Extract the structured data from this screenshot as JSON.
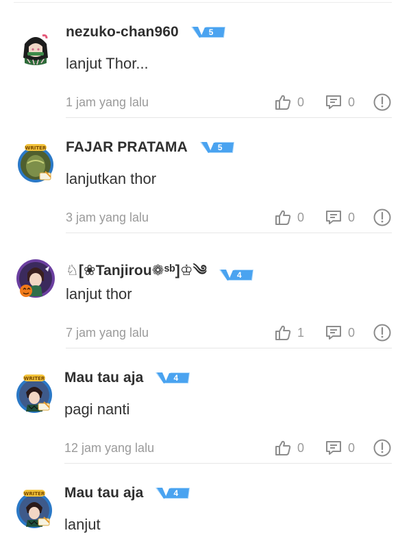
{
  "comments": [
    {
      "username": "nezuko-chan960",
      "level": "5",
      "text": "lanjut Thor...",
      "time": "1 jam yang lalu",
      "likes": "0",
      "replies": "0",
      "avatar_icon": "avatar-nezuko-icon"
    },
    {
      "username": "FAJAR PRATAMA",
      "level": "5",
      "text": "lanjutkan thor",
      "time": "3 jam yang lalu",
      "likes": "0",
      "replies": "0",
      "avatar_icon": "avatar-writer-frame-icon"
    },
    {
      "username": "♘[❀Tanjirou❁ˢᵇ]♔༄",
      "level": "4",
      "text": "lanjut thor",
      "time": "7 jam yang lalu",
      "likes": "1",
      "replies": "0",
      "avatar_icon": "avatar-halloween-icon"
    },
    {
      "username": "Mau tau aja",
      "level": "4",
      "text": "pagi nanti",
      "time": "12 jam yang lalu",
      "likes": "0",
      "replies": "0",
      "avatar_icon": "avatar-writer-frame-icon"
    },
    {
      "username": "Mau tau aja",
      "level": "4",
      "text": "lanjut",
      "time": "",
      "likes": "",
      "replies": "",
      "avatar_icon": "avatar-writer-frame-icon"
    }
  ],
  "colors": {
    "badge_blue": "#4aa3f0",
    "badge_light": "#a9d6fb",
    "text_dark": "#2f2f2f",
    "text_muted": "#9a9a9a",
    "icon_gray": "#8c8c8c",
    "divider": "#e6e6e6"
  }
}
